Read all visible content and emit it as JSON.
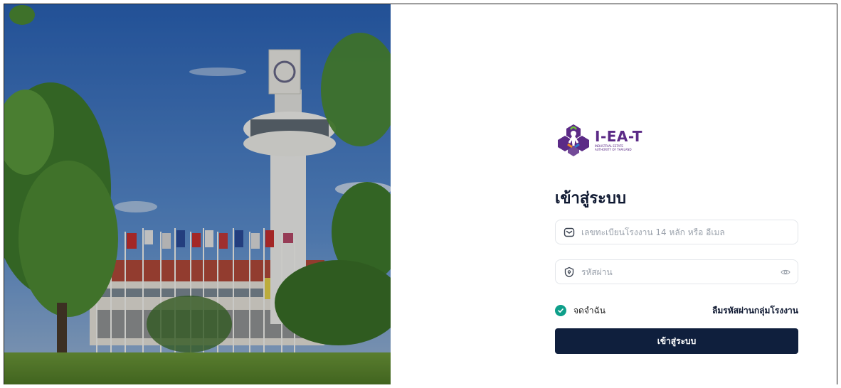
{
  "brand": {
    "name": "I-EA-T",
    "subtitle_line1": "INDUSTRIAL ESTATE",
    "subtitle_line2": "AUTHORITY OF THAILAND"
  },
  "login": {
    "title": "เข้าสู่ระบบ",
    "email_placeholder": "เลขทะเบียนโรงงาน 14 หลัก หรือ อีเมล",
    "email_icon": "mail-icon",
    "password_placeholder": "รหัสผ่าน",
    "password_icon": "lock-icon",
    "password_toggle_icon": "eye-icon",
    "remember_label": "จดจำฉัน",
    "remember_checked": true,
    "forgot_link": "ลืมรหัสผ่านกลุ่มโรงงาน",
    "submit_label": "เข้าสู่ระบบ"
  },
  "colors": {
    "brand_purple": "#5b2a86",
    "primary_navy": "#0f1f3d",
    "check_teal": "#0e9f8a"
  }
}
